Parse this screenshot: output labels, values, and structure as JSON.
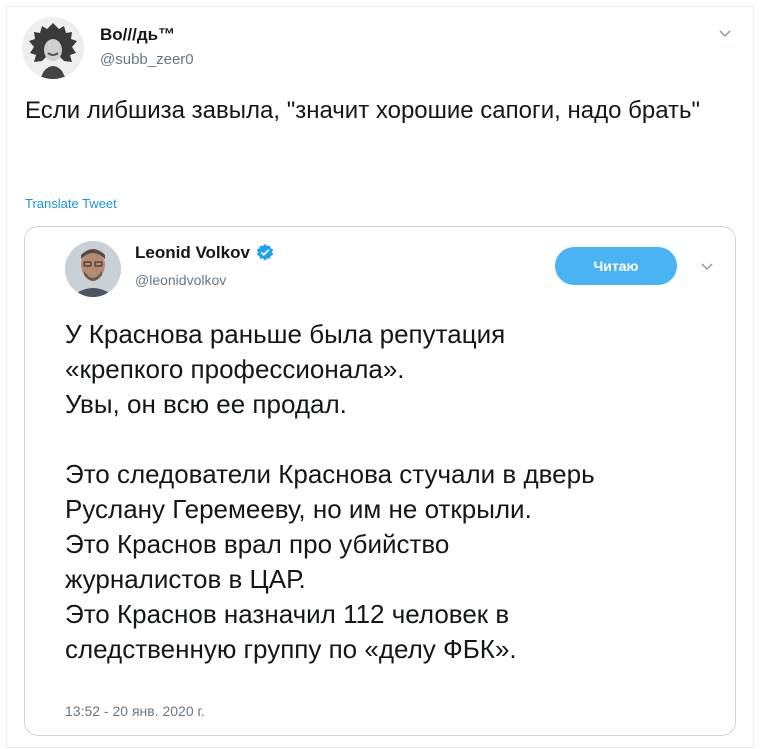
{
  "tweet": {
    "author_name": "Во///дь™",
    "author_handle": "@subb_zeer0",
    "text": "Если либшиза завыла, \"значит хорошие сапоги, надо брать\"",
    "translate_label": "Translate Tweet",
    "menu_icon": "chevron-down-icon"
  },
  "quoted_tweet": {
    "author_name": "Leonid Volkov",
    "verified": true,
    "author_handle": "@leonidvolkov",
    "follow_button_label": "Читаю",
    "menu_icon": "chevron-down-icon",
    "paragraphs": [
      [
        "У Краснова раньше была репутация",
        "«крепкого профессионала».",
        "Увы, он всю ее продал."
      ],
      [
        "Это следователи Краснова стучали в дверь",
        "Руслану Геремееву, но им не открыли.",
        "Это Краснов врал про убийство",
        "журналистов в ЦАР.",
        "Это Краснов назначил 112 человек в",
        "следственную группу по «делу ФБК»."
      ]
    ],
    "timestamp": "13:52 - 20 янв. 2020 г."
  },
  "colors": {
    "link": "#1b95e0",
    "follow_button": "#4ab3f4",
    "verified_badge": "#1da1f2",
    "secondary_text": "#657786",
    "border": "#ccd6dd"
  }
}
